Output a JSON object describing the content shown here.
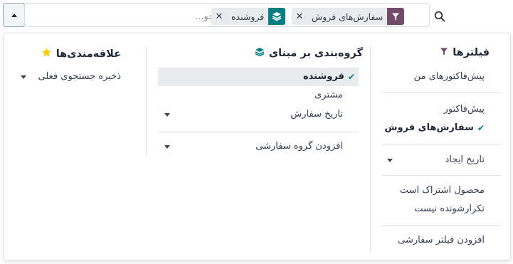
{
  "search": {
    "placeholder": "جستجو...",
    "facets": [
      {
        "label": "سفارش‌های فروش",
        "type": "filter",
        "color": "#714b67"
      },
      {
        "label": "فروشنده",
        "type": "groupby",
        "color": "#017e84"
      }
    ]
  },
  "filters": {
    "title": "فیلترها",
    "items": [
      {
        "label": "پیش‌فاکتورهای من",
        "selected": false
      },
      {
        "label": "پیش‌فاکتور",
        "selected": false
      },
      {
        "label": "سفارش‌های فروش",
        "selected": true
      },
      {
        "label": "تاریخ ایجاد",
        "dropdown": true
      },
      {
        "label": "محصول اشتراک است",
        "selected": false
      },
      {
        "label": "تکرارشونده نیست",
        "selected": false
      },
      {
        "label": "افزودن فیلتر سفارشی"
      }
    ]
  },
  "groupby": {
    "title": "گروه‌بندی بر مبنای",
    "items": [
      {
        "label": "فروشنده",
        "selected": true
      },
      {
        "label": "مشتری",
        "selected": false
      },
      {
        "label": "تاریخ سفارش",
        "dropdown": true
      },
      {
        "label": "افزودن گروه سفارشی",
        "dropdown": true
      }
    ]
  },
  "favorites": {
    "title": "علاقه‌مندی‌ها",
    "items": [
      {
        "label": "ذخیره جستجوی فعلی",
        "dropdown": true
      }
    ]
  },
  "colors": {
    "filter_accent": "#714b67",
    "groupby_accent": "#017e84",
    "favorite_star": "#f3cc00"
  }
}
